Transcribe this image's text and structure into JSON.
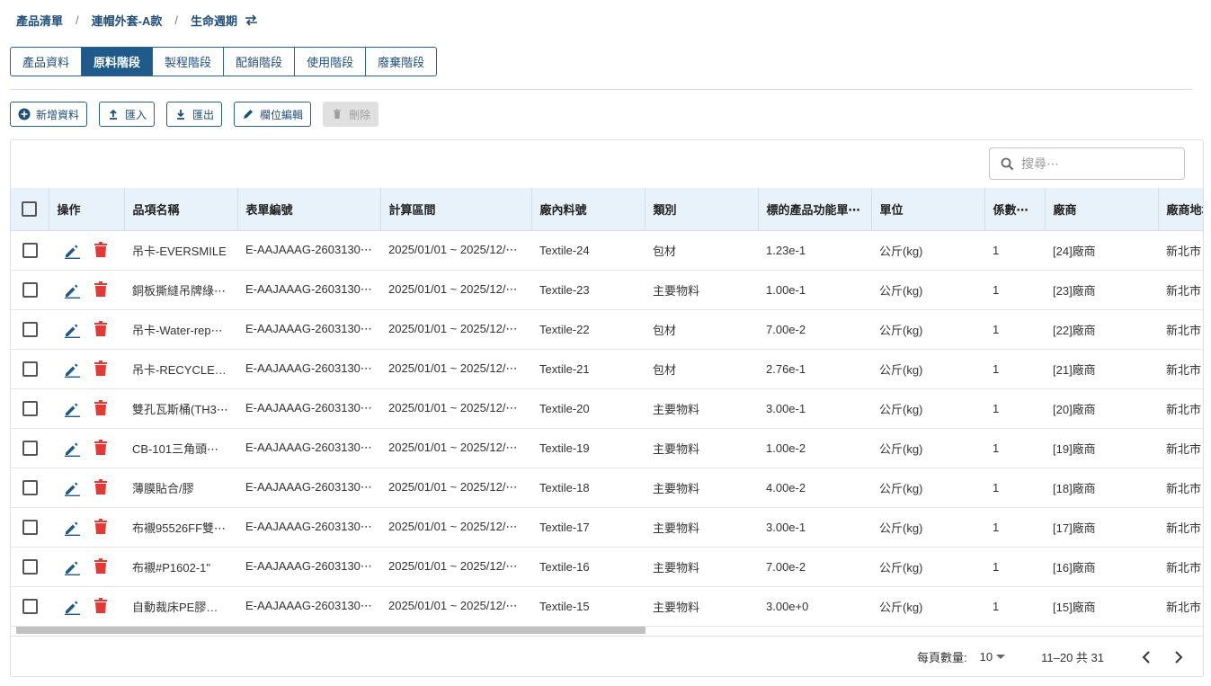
{
  "breadcrumb": {
    "items": [
      "產品清單",
      "連帽外套-A款",
      "生命週期"
    ],
    "swap_icon": "swap-icon"
  },
  "tabs": [
    {
      "label": "產品資料",
      "active": false
    },
    {
      "label": "原料階段",
      "active": true
    },
    {
      "label": "製程階段",
      "active": false
    },
    {
      "label": "配銷階段",
      "active": false
    },
    {
      "label": "使用階段",
      "active": false
    },
    {
      "label": "廢棄階段",
      "active": false
    }
  ],
  "toolbar": {
    "add_label": "新增資料",
    "import_label": "匯入",
    "export_label": "匯出",
    "edit_columns_label": "欄位編輯",
    "delete_label": "刪除"
  },
  "search": {
    "placeholder": "搜尋⋯"
  },
  "table": {
    "headers": [
      "操作",
      "品項名稱",
      "表單編號",
      "計算區間",
      "廠內料號",
      "類別",
      "標的產品功能單⋯",
      "單位",
      "係數⋯",
      "廠商",
      "廠商地址"
    ],
    "rows": [
      [
        "吊卡-EVERSMILE",
        "E-AAJAAAG-2603130⋯",
        "2025/01/01 ~ 2025/12/⋯",
        "Textile-24",
        "包材",
        "1.23e-1",
        "公斤(kg)",
        "1",
        "[24]廠商",
        "新北市"
      ],
      [
        "銅板撕縫吊牌綠⋯",
        "E-AAJAAAG-2603130⋯",
        "2025/01/01 ~ 2025/12/⋯",
        "Textile-23",
        "主要物料",
        "1.00e-1",
        "公斤(kg)",
        "1",
        "[23]廠商",
        "新北市"
      ],
      [
        "吊卡-Water-rep⋯",
        "E-AAJAAAG-2603130⋯",
        "2025/01/01 ~ 2025/12/⋯",
        "Textile-22",
        "包材",
        "7.00e-2",
        "公斤(kg)",
        "1",
        "[22]廠商",
        "新北市"
      ],
      [
        "吊卡-RECYCLE(⋯",
        "E-AAJAAAG-2603130⋯",
        "2025/01/01 ~ 2025/12/⋯",
        "Textile-21",
        "包材",
        "2.76e-1",
        "公斤(kg)",
        "1",
        "[21]廠商",
        "新北市"
      ],
      [
        "雙孔瓦斯桶(TH3⋯",
        "E-AAJAAAG-2603130⋯",
        "2025/01/01 ~ 2025/12/⋯",
        "Textile-20",
        "主要物料",
        "3.00e-1",
        "公斤(kg)",
        "1",
        "[20]廠商",
        "新北市"
      ],
      [
        "CB-101三角頭⋯",
        "E-AAJAAAG-2603130⋯",
        "2025/01/01 ~ 2025/12/⋯",
        "Textile-19",
        "主要物料",
        "1.00e-2",
        "公斤(kg)",
        "1",
        "[19]廠商",
        "新北市"
      ],
      [
        "薄膜貼合/膠",
        "E-AAJAAAG-2603130⋯",
        "2025/01/01 ~ 2025/12/⋯",
        "Textile-18",
        "主要物料",
        "4.00e-2",
        "公斤(kg)",
        "1",
        "[18]廠商",
        "新北市"
      ],
      [
        "布襯95526FF雙⋯",
        "E-AAJAAAG-2603130⋯",
        "2025/01/01 ~ 2025/12/⋯",
        "Textile-17",
        "主要物料",
        "3.00e-1",
        "公斤(kg)",
        "1",
        "[17]廠商",
        "新北市"
      ],
      [
        "布襯#P1602-1\"",
        "E-AAJAAAG-2603130⋯",
        "2025/01/01 ~ 2025/12/⋯",
        "Textile-16",
        "主要物料",
        "7.00e-2",
        "公斤(kg)",
        "1",
        "[16]廠商",
        "新北市"
      ],
      [
        "自動裁床PE膠膜⋯",
        "E-AAJAAAG-2603130⋯",
        "2025/01/01 ~ 2025/12/⋯",
        "Textile-15",
        "主要物料",
        "3.00e+0",
        "公斤(kg)",
        "1",
        "[15]廠商",
        "新北市"
      ]
    ]
  },
  "pagination": {
    "rows_per_page_label": "每頁數量:",
    "rows_per_page": "10",
    "range": "11–20 共 31"
  },
  "colors": {
    "primary": "#1f5a8a",
    "header_bg": "#e8f2fb",
    "edit_icon": "#1f5a8a",
    "delete_icon": "#e53935"
  }
}
